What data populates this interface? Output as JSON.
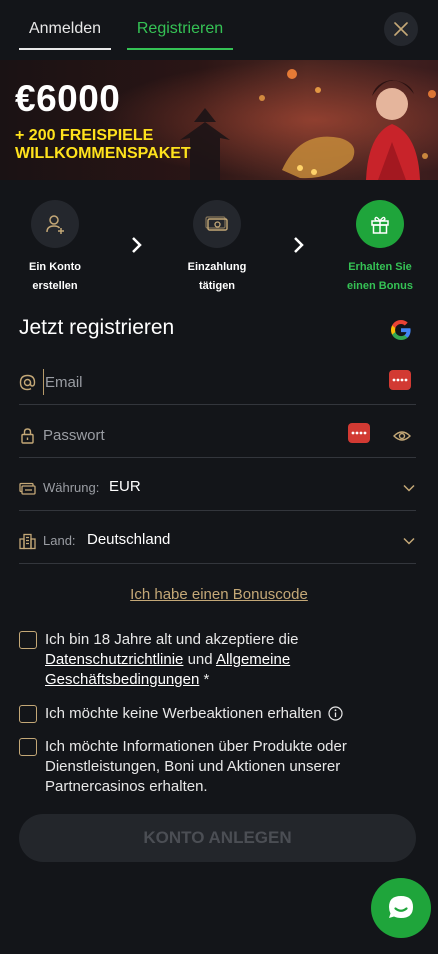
{
  "tabs": {
    "login": "Anmelden",
    "register": "Registrieren"
  },
  "banner": {
    "amount": "€6000",
    "subtitle_line1": "+ 200 FREISPIELE",
    "subtitle_line2": "WILLKOMMENSPAKET"
  },
  "steps": [
    {
      "line1": "Ein Konto",
      "line2": "erstellen",
      "icon": "user-add-icon",
      "active": false
    },
    {
      "line1": "Einzahlung",
      "line2": "tätigen",
      "icon": "money-icon",
      "active": false
    },
    {
      "line1": "Erhalten Sie",
      "line2": "einen Bonus",
      "icon": "gift-icon",
      "active": true
    }
  ],
  "form": {
    "title": "Jetzt registrieren",
    "email_placeholder": "Email",
    "password_placeholder": "Passwort",
    "currency_label": "Währung:",
    "currency_value": "EUR",
    "country_label": "Land:",
    "country_value": "Deutschland",
    "bonus_code_link": "Ich habe einen Bonuscode",
    "terms": {
      "text1": "Ich bin 18 Jahre alt und akzeptiere die",
      "privacy_link": "Datenschutzrichtlinie",
      "and": " und ",
      "general_link": "Allgemeine",
      "terms_link": "Geschäftsbedingungen",
      "required_mark": " *"
    },
    "no_promos": "Ich möchte keine Werbeaktionen erhalten",
    "partner_info": "Ich möchte Informationen über Produkte oder Dienstleistungen, Boni und Aktionen unserer Partnercasinos erhalten.",
    "submit": "KONTO ANLEGEN"
  },
  "colors": {
    "accent_green": "#35c255",
    "gold": "#c4a877",
    "banner_yellow": "#ffe21c",
    "background": "#131519"
  }
}
